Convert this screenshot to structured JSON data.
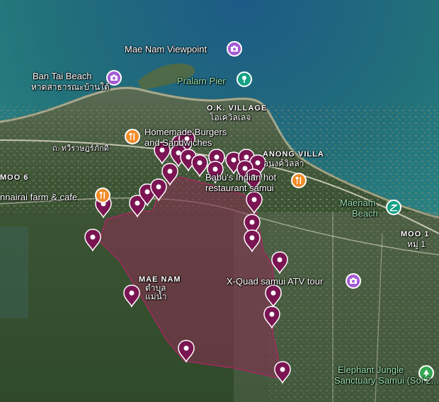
{
  "map": {
    "colors": {
      "sea_deep": "#1e5f7a",
      "sea_shallow": "#2f8a8e",
      "land": "#364f30",
      "town": "#6f6e63",
      "polygon_fill": "#8a2d52",
      "polygon_stroke": "#a12a5e",
      "pin": "#7b1452",
      "poi_purple": "#a55bd6",
      "poi_orange": "#f28c28",
      "poi_teal": "#16a085",
      "poi_green": "#34a853"
    },
    "labels": {
      "mae_nam_viewpoint": "Mae Nam Viewpoint",
      "ban_tai_beach": "Ban Tai Beach",
      "ban_tai_beach_thai": "หาดสาธารณะบ้านใต้",
      "pralarn_pier": "Pralarn Pier",
      "ok_village": "O.K. VILLAGE",
      "ok_village_thai": "โอเควิลเลจ",
      "homemade_burgers_1": "Homemade Burgers",
      "homemade_burgers_2": "and Sandwiches",
      "road_thai": "ถ. ทวีราษฎร์ภักดี",
      "anong_villa": "ANONG VILLA",
      "anong_villa_thai": "อนงค์วิลล่า",
      "moo6": "MOO 6",
      "babus_1": "Babu's Indian hot",
      "babus_2": "restaurant samui",
      "farm_cafe": "nnairai farm & cafe",
      "maenam_beach_1": "Maenam",
      "maenam_beach_2": "Beach",
      "moo1": "MOO 1",
      "moo1_thai": "หมู่ 1",
      "mae_nam": "MAE NAM",
      "mae_nam_thai_1": "ตำบล",
      "mae_nam_thai_2": "แม่น้ำ",
      "xquad": "X-Quad samui ATV tour",
      "elephant_1": "Elephant Jungle",
      "elephant_2": "Sanctuary Samui (Soi 2..."
    },
    "pois": [
      {
        "name": "camera-icon",
        "color": "poi_purple"
      },
      {
        "name": "restaurant-icon",
        "color": "poi_orange"
      },
      {
        "name": "pier-icon",
        "color": "poi_teal"
      },
      {
        "name": "beach-icon",
        "color": "poi_teal"
      },
      {
        "name": "tree-icon",
        "color": "poi_green"
      }
    ]
  }
}
